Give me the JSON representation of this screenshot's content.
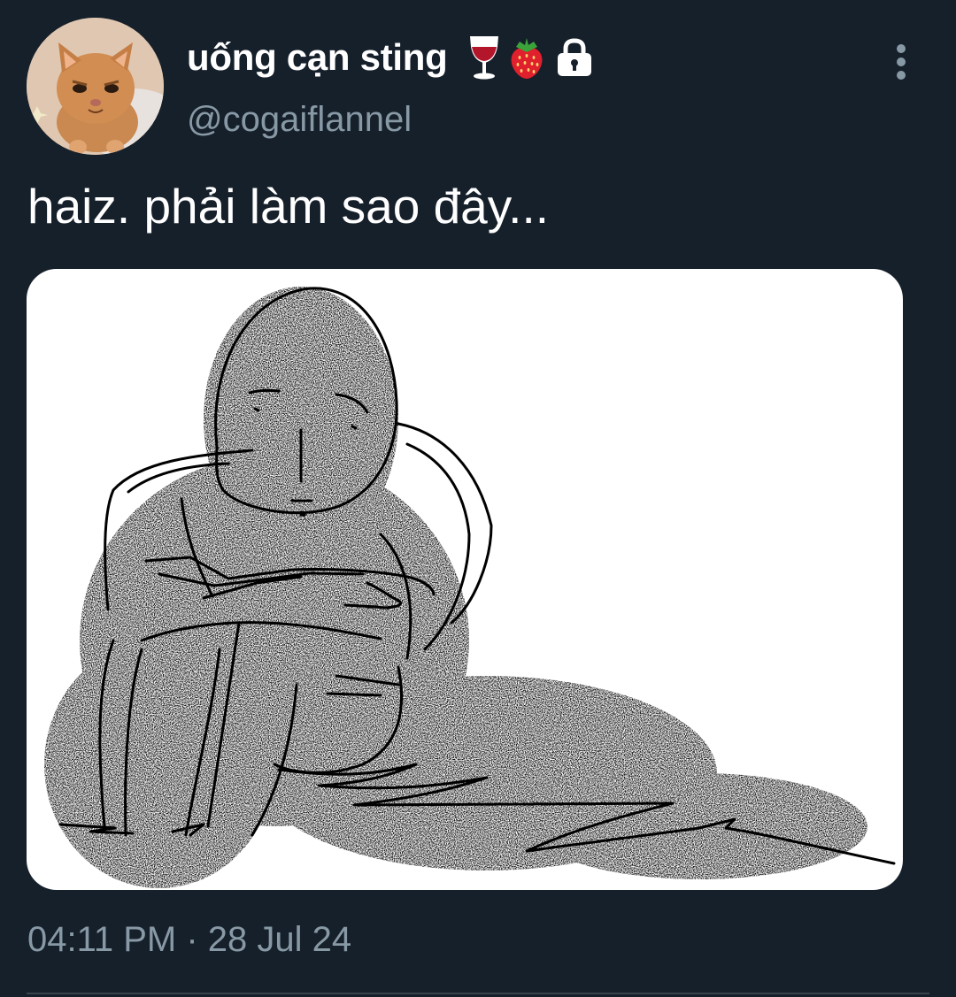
{
  "user": {
    "display_name": "uống cạn sting",
    "handle": "@cogaiflannel",
    "avatar_icon": "kitten-avatar",
    "badges": [
      "wine-glass-emoji",
      "strawberry-emoji",
      "lock-icon"
    ]
  },
  "tweet": {
    "text": "haiz. phải làm sao đây...",
    "media_icon": "sad-sketch-figure-drawing",
    "timestamp": "04:11 PM · 28 Jul 24"
  },
  "menu": {
    "icon": "more-options-icon"
  },
  "colors": {
    "background": "#16202b",
    "primary_text": "#ffffff",
    "secondary_text": "#8899a6",
    "divider": "#38444d"
  }
}
